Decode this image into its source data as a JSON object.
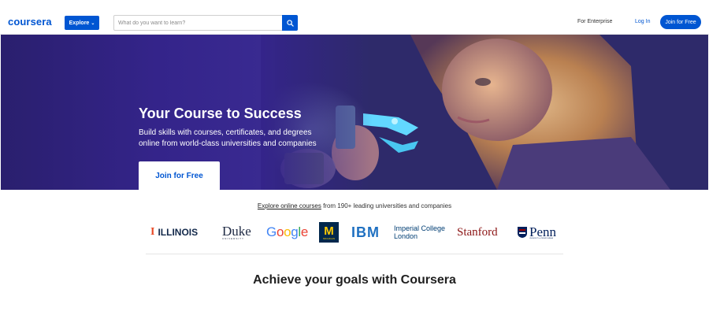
{
  "nav": {
    "logo": "coursera",
    "explore_label": "Explore",
    "search_placeholder": "What do you want to learn?",
    "for_enterprise": "For Enterprise",
    "login": "Log In",
    "join": "Join for Free"
  },
  "hero": {
    "title": "Your Course to Success",
    "subtitle_line1": "Build skills with courses, certificates, and degrees",
    "subtitle_line2": "online from world-class universities and companies",
    "cta": "Join for Free"
  },
  "partners": {
    "link_text": "Explore online courses",
    "rest_text": " from 190+ leading universities and companies",
    "logos": [
      {
        "name": "ILLINOIS",
        "mark": "I",
        "color": "#13294b",
        "accent": "#e84a27"
      },
      {
        "name": "Duke",
        "sub": "UNIVERSITY",
        "color": "#1f2a44"
      },
      {
        "name": "Google",
        "colors": [
          "#4285f4",
          "#ea4335",
          "#fbbc05",
          "#4285f4",
          "#34a853",
          "#ea4335"
        ]
      },
      {
        "name": "M",
        "sub": "MICHIGAN",
        "color": "#00274c",
        "accent": "#ffcb05"
      },
      {
        "name": "IBM",
        "color": "#1f70c1"
      },
      {
        "name_line1": "Imperial College",
        "name_line2": "London",
        "color": "#003e74"
      },
      {
        "name": "Stanford",
        "color": "#8c1515"
      },
      {
        "name": "Penn",
        "sub": "UNIVERSITY of PENNSYLVANIA",
        "color": "#011f5b"
      }
    ]
  },
  "section": {
    "title": "Achieve your goals with Coursera"
  },
  "colors": {
    "brand": "#0056d2",
    "hero_bg": "#34248a"
  },
  "icons": {
    "search": "search-icon",
    "chevron": "chevron-down-icon"
  }
}
